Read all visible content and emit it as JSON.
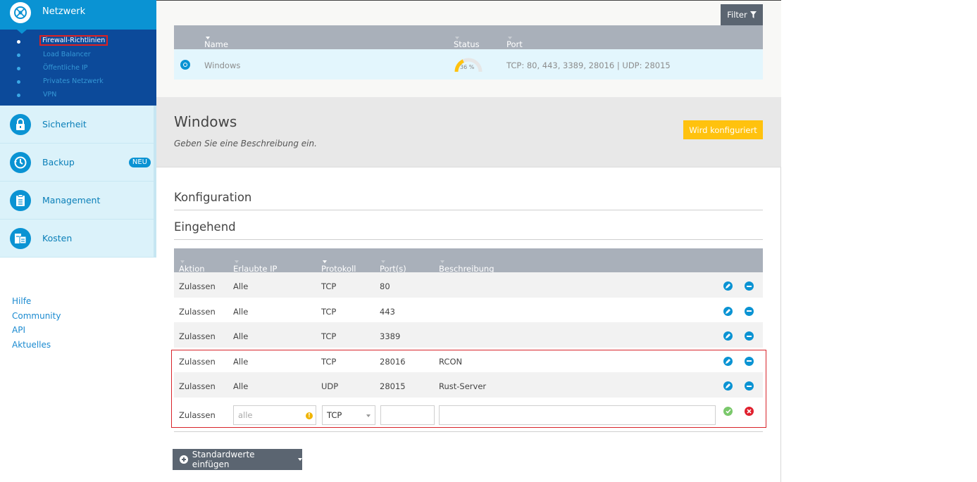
{
  "sidebar": {
    "network": {
      "label": "Netzwerk",
      "sub_items": [
        {
          "label": "Firewall-Richtlinien",
          "active": true
        },
        {
          "label": "Load Balancer"
        },
        {
          "label": "Öffentliche IP"
        },
        {
          "label": "Privates Netzwerk"
        },
        {
          "label": "VPN"
        }
      ]
    },
    "items": [
      {
        "label": "Sicherheit",
        "icon": "lock-icon"
      },
      {
        "label": "Backup",
        "icon": "clock-icon",
        "badge": "NEU"
      },
      {
        "label": "Management",
        "icon": "clipboard-icon"
      },
      {
        "label": "Kosten",
        "icon": "bills-icon"
      }
    ],
    "footer_links": [
      "Hilfe",
      "Community",
      "API",
      "Aktuelles"
    ]
  },
  "server_list": {
    "filter_label": "Filter",
    "columns": [
      "Name",
      "Status",
      "Port"
    ],
    "row": {
      "name": "Windows",
      "status_percent": "36 %",
      "status_value": 36,
      "ports": "TCP: 80, 443, 3389, 28016 | UDP: 28015"
    }
  },
  "detail": {
    "title": "Windows",
    "description": "Geben Sie eine Beschreibung ein.",
    "status_button": "Wird konfiguriert"
  },
  "config": {
    "title": "Konfiguration",
    "incoming_title": "Eingehend",
    "columns": [
      "Aktion",
      "Erlaubte IP",
      "Protokoll",
      "Port(s)",
      "Beschreibung"
    ],
    "rules": [
      {
        "action": "Zulassen",
        "ip": "Alle",
        "protocol": "TCP",
        "ports": "80",
        "description": ""
      },
      {
        "action": "Zulassen",
        "ip": "Alle",
        "protocol": "TCP",
        "ports": "443",
        "description": ""
      },
      {
        "action": "Zulassen",
        "ip": "Alle",
        "protocol": "TCP",
        "ports": "3389",
        "description": ""
      },
      {
        "action": "Zulassen",
        "ip": "Alle",
        "protocol": "TCP",
        "ports": "28016",
        "description": "RCON"
      },
      {
        "action": "Zulassen",
        "ip": "Alle",
        "protocol": "UDP",
        "ports": "28015",
        "description": "Rust-Server"
      }
    ],
    "new_rule": {
      "action": "Zulassen",
      "ip_placeholder": "alle",
      "protocol": "TCP",
      "ports": "",
      "description": ""
    },
    "defaults_button": "Standardwerte einfügen"
  },
  "colors": {
    "accent": "#0a93d3",
    "sidebar_dark": "#0c4a9a",
    "status_yellow": "#ffc20e",
    "highlight_red": "#d8242a"
  }
}
